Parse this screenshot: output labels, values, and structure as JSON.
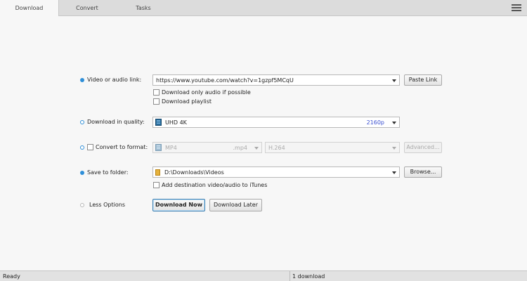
{
  "tabs": [
    {
      "label": "Download",
      "active": true
    },
    {
      "label": "Convert",
      "active": false
    },
    {
      "label": "Tasks",
      "active": false
    }
  ],
  "menu_icon": "hamburger-menu-icon",
  "link": {
    "label": "Video or audio link:",
    "value": "https://www.youtube.com/watch?v=1gzpf5MCqU",
    "paste_button": "Paste Link",
    "audio_only_label": "Download only audio if possible",
    "audio_only_checked": false,
    "playlist_label": "Download playlist",
    "playlist_checked": false
  },
  "quality": {
    "label": "Download in quality:",
    "value": "UHD 4K",
    "resolution": "2160p",
    "selected": false
  },
  "convert": {
    "label": "Convert to format:",
    "checked": false,
    "format_name": "MP4",
    "format_ext": ".mp4",
    "codec": "H.264",
    "advanced_button": "Advanced...",
    "selected": false
  },
  "folder": {
    "label": "Save to folder:",
    "value": "D:\\Downloads\\Videos",
    "browse_button": "Browse...",
    "itunes_label": "Add destination video/audio to iTunes",
    "itunes_checked": false,
    "selected": true
  },
  "actions": {
    "less_options": "Less Options",
    "download_now": "Download Now",
    "download_later": "Download Later"
  },
  "status": {
    "left": "Ready",
    "right": "1 download"
  },
  "colors": {
    "accent": "#2f8fd8",
    "quality_value": "#3a4fd1"
  }
}
